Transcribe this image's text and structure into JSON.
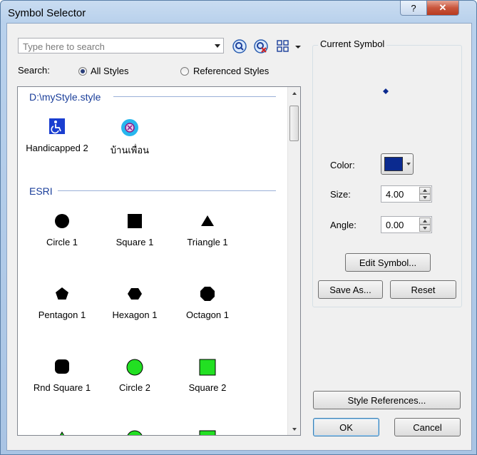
{
  "window": {
    "title": "Symbol Selector",
    "help_label": "?",
    "close_label": "✕"
  },
  "search": {
    "placeholder": "Type here to search",
    "value": ""
  },
  "search_scope": {
    "label": "Search:",
    "option_all": "All Styles",
    "option_referenced": "Referenced Styles",
    "selected": "All Styles"
  },
  "groups": [
    {
      "name": "D:\\myStyle.style",
      "symbols": [
        {
          "name": "Handicapped 2",
          "icon": "wheelchair-icon"
        },
        {
          "name": "บ้านเพื่อน",
          "icon": "blue-circle-x-icon"
        }
      ]
    },
    {
      "name": "ESRI",
      "symbols": [
        {
          "name": "Circle 1",
          "icon": "black-circle-icon"
        },
        {
          "name": "Square 1",
          "icon": "black-square-icon"
        },
        {
          "name": "Triangle 1",
          "icon": "black-triangle-icon"
        },
        {
          "name": "Pentagon 1",
          "icon": "black-pentagon-icon"
        },
        {
          "name": "Hexagon 1",
          "icon": "black-hexagon-icon"
        },
        {
          "name": "Octagon 1",
          "icon": "black-octagon-icon"
        },
        {
          "name": "Rnd Square 1",
          "icon": "black-rounded-square-icon"
        },
        {
          "name": "Circle 2",
          "icon": "green-circle-icon"
        },
        {
          "name": "Square 2",
          "icon": "green-square-icon"
        }
      ]
    }
  ],
  "current_symbol": {
    "title": "Current Symbol",
    "color_label": "Color:",
    "color": "#0b2a8f",
    "size_label": "Size:",
    "size": "4.00",
    "angle_label": "Angle:",
    "angle": "0.00"
  },
  "buttons": {
    "edit_symbol": "Edit Symbol...",
    "save_as": "Save As...",
    "reset": "Reset",
    "style_references": "Style References...",
    "ok": "OK",
    "cancel": "Cancel"
  },
  "colors": {
    "accent_blue": "#1a3e9a",
    "symbol_green": "#22e022"
  }
}
